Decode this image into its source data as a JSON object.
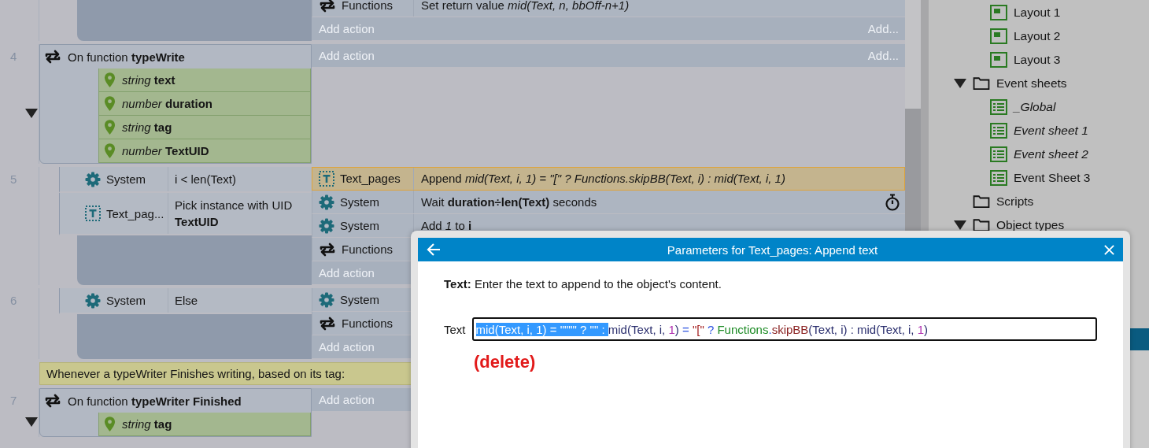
{
  "event_sheet": {
    "events": [
      {
        "kind": "continuation",
        "actions": [
          {
            "kind": "function",
            "object": "Functions",
            "text": "Set return value *mid(Text, n, bbOff-n+1)*",
            "selected": false,
            "timer": false
          },
          {
            "kind": "add",
            "label": "Add action",
            "link": "Add..."
          }
        ]
      },
      {
        "kind": "function",
        "number": "4",
        "expanded": true,
        "label": "On function **typeWrite**",
        "params": [
          {
            "type": "string",
            "name": "text"
          },
          {
            "type": "number",
            "name": "duration"
          },
          {
            "type": "string",
            "name": "tag"
          },
          {
            "type": "number",
            "name": "TextUID"
          }
        ],
        "actions": [
          {
            "kind": "add",
            "label": "Add action",
            "link": "Add..."
          }
        ],
        "children": [
          {
            "kind": "conditions",
            "number": "5",
            "conditions": [
              {
                "kind": "system",
                "object": "System",
                "text": "i < len(Text)"
              },
              {
                "kind": "text_object",
                "object": "Text_pag...",
                "text": "Pick instance with UID **TextUID**"
              }
            ],
            "actions": [
              {
                "kind": "text_object",
                "object": "Text_pages",
                "text": "Append *mid(Text, i, 1) = \"[\" ? Functions.skipBB(Text, i) : mid(Text, i, 1)*",
                "selected": true,
                "timer": false
              },
              {
                "kind": "system",
                "object": "System",
                "text": "Wait **duration÷len(Text)** seconds",
                "selected": false,
                "timer": true
              },
              {
                "kind": "system",
                "object": "System",
                "text": "Add *1* to **i**",
                "selected": false,
                "timer": false
              },
              {
                "kind": "function",
                "object": "Functions",
                "selected": false,
                "timer": false
              },
              {
                "kind": "add",
                "label": "Add action"
              }
            ]
          },
          {
            "kind": "conditions",
            "number": "6",
            "conditions": [
              {
                "kind": "system",
                "object": "System",
                "text": "Else"
              }
            ],
            "actions": [
              {
                "kind": "system",
                "object": "System",
                "selected": false,
                "timer": false
              },
              {
                "kind": "function",
                "object": "Functions",
                "selected": false,
                "timer": false
              },
              {
                "kind": "add",
                "label": "Add action"
              }
            ]
          }
        ]
      },
      {
        "kind": "comment",
        "text": "Whenever a typeWriter Finishes writing, based on its tag:"
      },
      {
        "kind": "function",
        "number": "7",
        "expanded": true,
        "label": "On function **typeWriter Finished**",
        "params": [
          {
            "type": "string",
            "name": "tag"
          }
        ],
        "actions": [
          {
            "kind": "add",
            "label": "Add action"
          }
        ]
      }
    ]
  },
  "project_tree": [
    {
      "kind": "layout",
      "label": "Layout 1"
    },
    {
      "kind": "layout",
      "label": "Layout 2"
    },
    {
      "kind": "layout",
      "label": "Layout 3"
    },
    {
      "kind": "folder",
      "label": "Event sheets",
      "expanded": true,
      "children": [
        {
          "kind": "sheet",
          "label": "_Global",
          "italic": true
        },
        {
          "kind": "sheet",
          "label": "Event sheet 1",
          "italic": true
        },
        {
          "kind": "sheet",
          "label": "Event sheet 2",
          "italic": true
        },
        {
          "kind": "sheet",
          "label": "Event Sheet 3",
          "italic": false
        }
      ]
    },
    {
      "kind": "folder",
      "label": "Scripts"
    },
    {
      "kind": "folder",
      "label": "Object types",
      "expanded": true
    }
  ],
  "dialog": {
    "title": "Parameters for Text_pages: Append text",
    "description": "**Text:** Enter the text to append to the object's content.",
    "field": {
      "label": "Text",
      "segments": [
        {
          "text": "mid(Text, i, 1) = \"\"\"\" ? \"\" : ",
          "kind": "plain",
          "selected": true
        },
        {
          "text": "mid(Text, i, ",
          "kind": "plain",
          "selected": false
        },
        {
          "text": "1",
          "kind": "number",
          "selected": false
        },
        {
          "text": ") ",
          "kind": "plain",
          "selected": false
        },
        {
          "text": "= ",
          "kind": "operator",
          "selected": false
        },
        {
          "text": "\"[\" ",
          "kind": "string",
          "selected": false
        },
        {
          "text": "? ",
          "kind": "operator",
          "selected": false
        },
        {
          "text": "Functions",
          "kind": "object",
          "selected": false
        },
        {
          "text": ".",
          "kind": "operator",
          "selected": false
        },
        {
          "text": "skipBB",
          "kind": "method",
          "selected": false
        },
        {
          "text": "(Text, i) : mid(Text, i, ",
          "kind": "plain",
          "selected": false
        },
        {
          "text": "1",
          "kind": "number",
          "selected": false
        },
        {
          "text": ")",
          "kind": "plain",
          "selected": false
        }
      ]
    },
    "annotation": "(delete)"
  }
}
